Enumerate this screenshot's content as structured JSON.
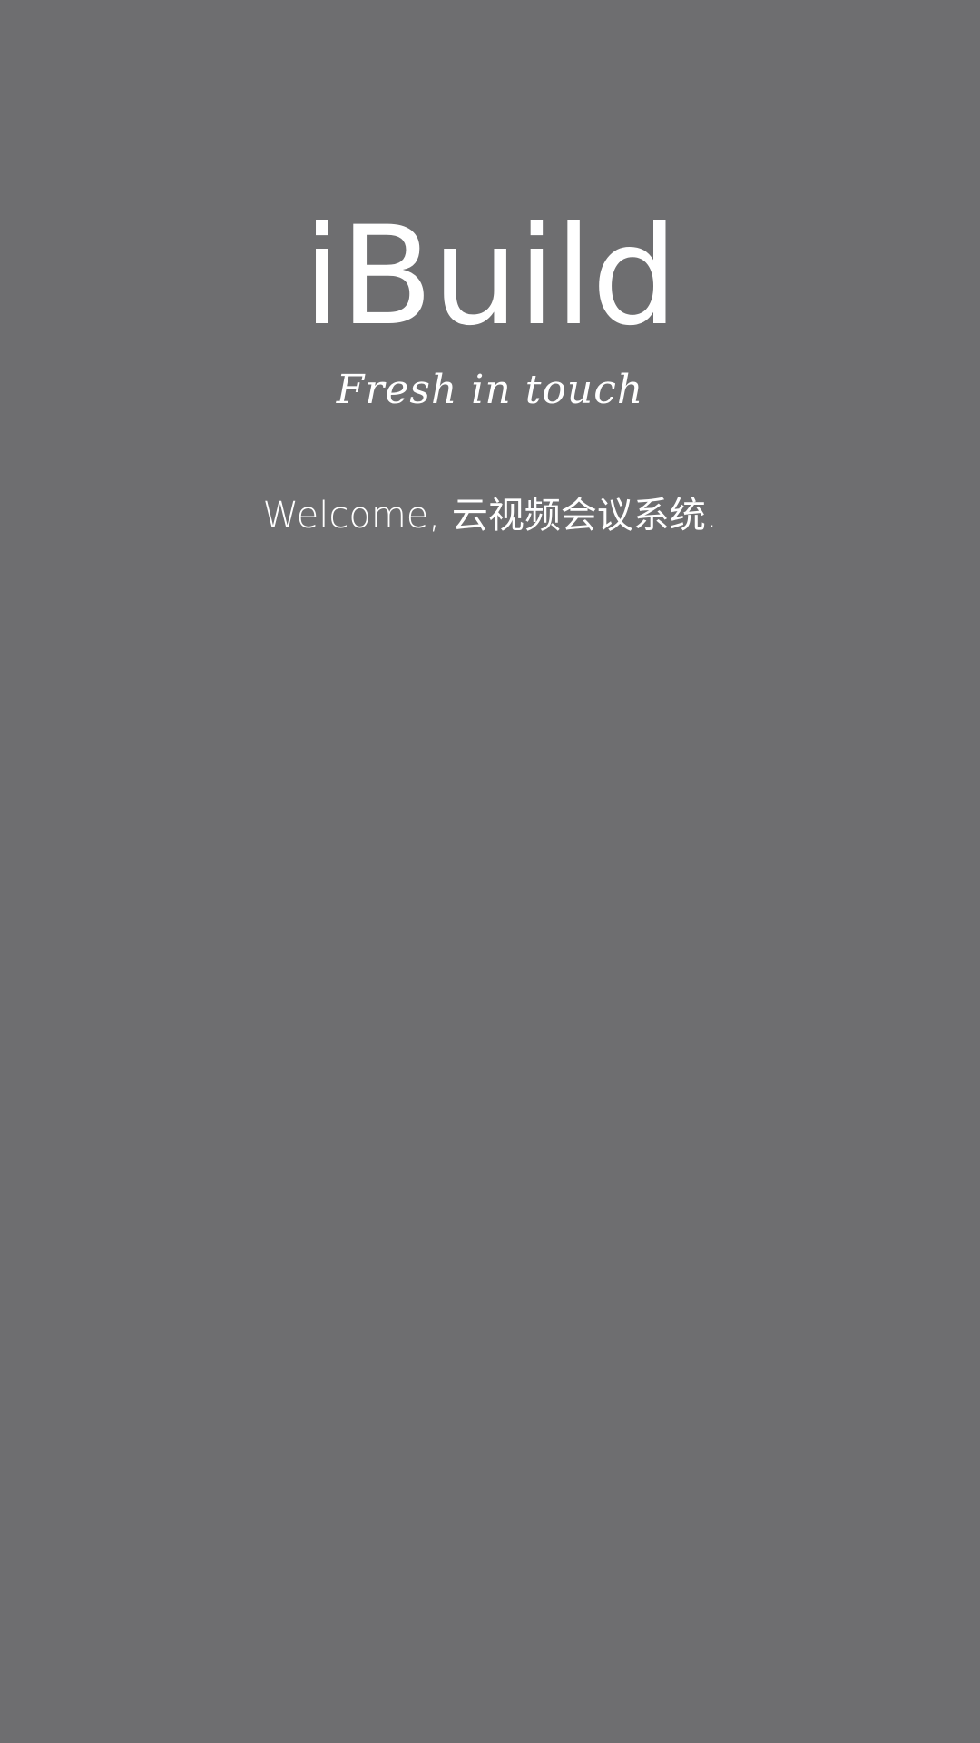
{
  "splash": {
    "app_name": "iBuild",
    "tagline": "Fresh in touch",
    "welcome_text": "Welcome, 云视频会议系统."
  },
  "colors": {
    "background": "#6e6e70",
    "text": "#ffffff"
  }
}
